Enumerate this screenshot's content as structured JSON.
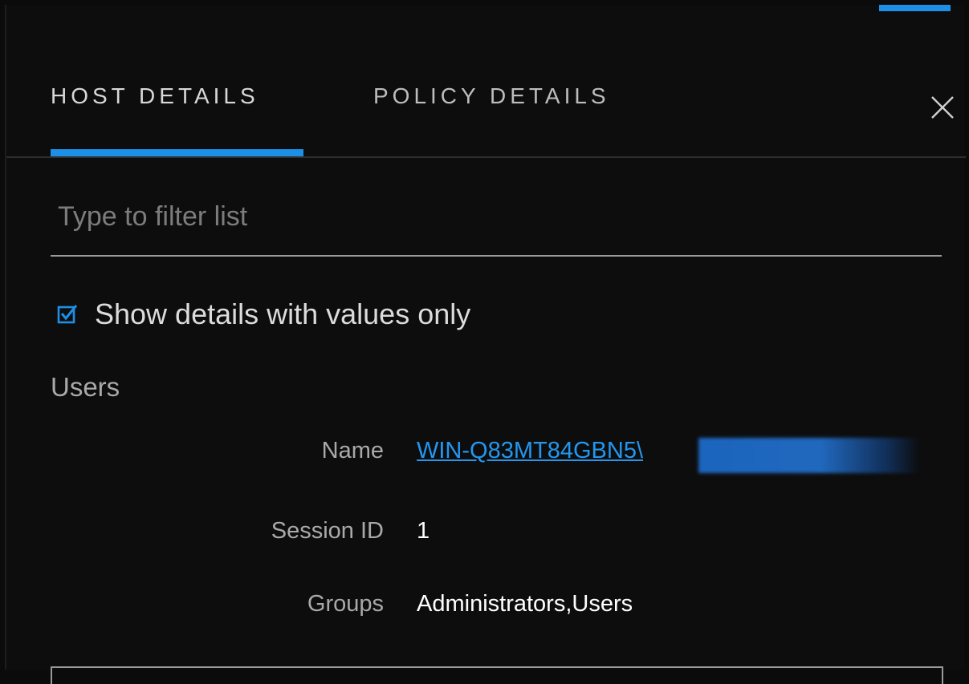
{
  "tabs": {
    "host_details": "HOST DETAILS",
    "policy_details": "POLICY DETAILS",
    "active": "host_details"
  },
  "close_icon": "close-icon",
  "filter": {
    "placeholder": "Type to filter list",
    "value": ""
  },
  "checkbox": {
    "label": "Show details with values only",
    "checked": true,
    "icon": "checkbox-checked-icon"
  },
  "section": {
    "title": "Users"
  },
  "details": [
    {
      "label": "Name",
      "value": "WIN-Q83MT84GBN5\\",
      "is_link": true,
      "redacted_suffix": true
    },
    {
      "label": "Session ID",
      "value": "1",
      "is_link": false
    },
    {
      "label": "Groups",
      "value": "Administrators,Users",
      "is_link": false
    }
  ],
  "colors": {
    "accent": "#1d8fe6",
    "link": "#2496ef",
    "background": "#0d0d0d",
    "label": "#a9a9a9",
    "value": "#ffffff"
  }
}
